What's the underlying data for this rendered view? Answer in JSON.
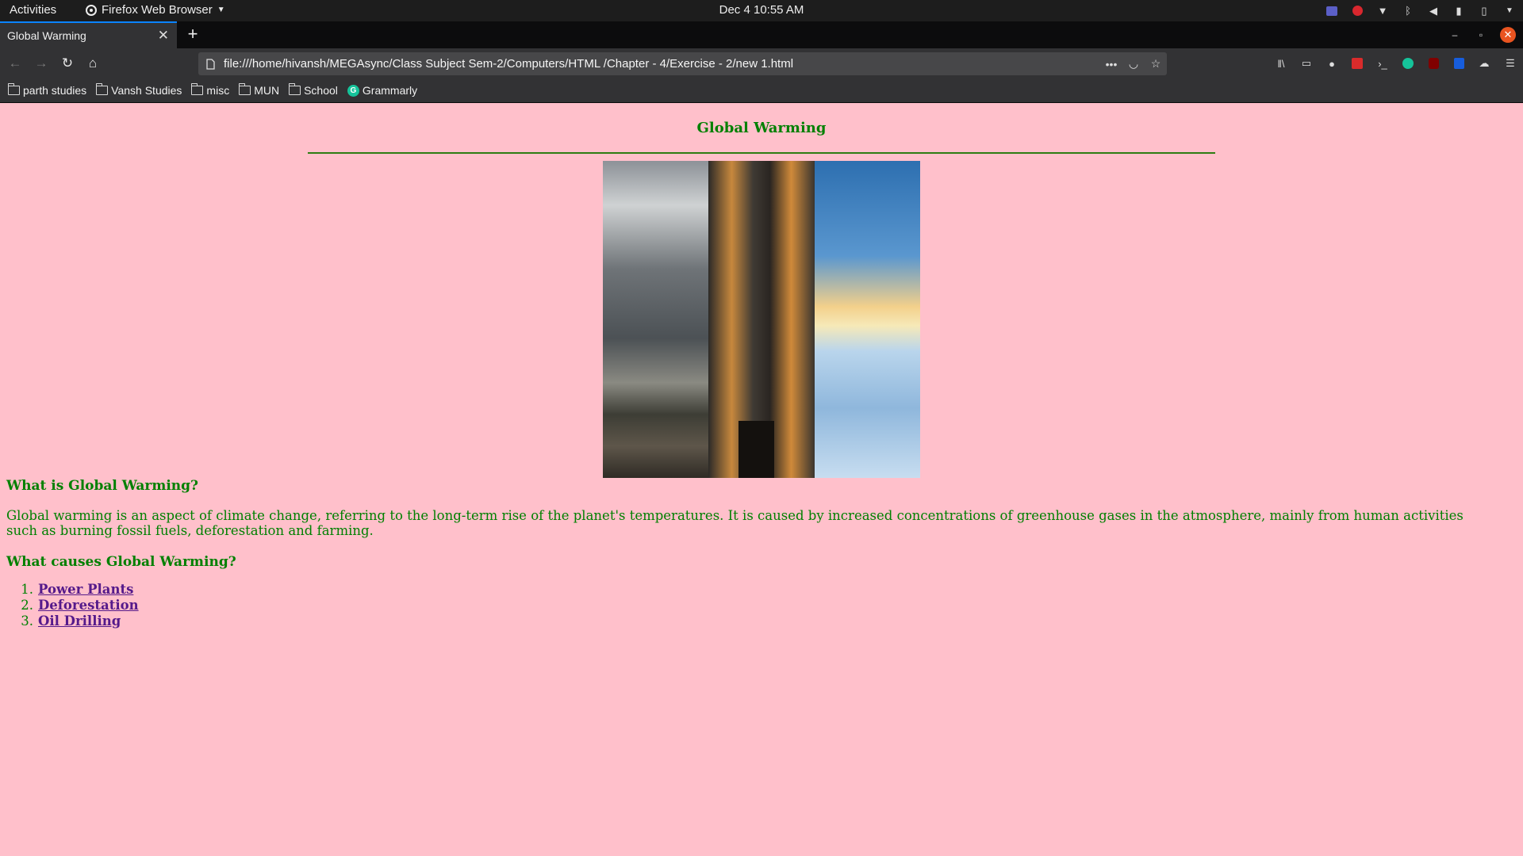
{
  "system": {
    "activities_label": "Activities",
    "app_name": "Firefox Web Browser",
    "clock": "Dec 4  10:55 AM"
  },
  "browser": {
    "tab_title": "Global Warming",
    "url": "file:///home/hivansh/MEGAsync/Class Subject Sem-2/Computers/HTML /Chapter - 4/Exercise - 2/new 1.html",
    "bookmarks": [
      {
        "label": "parth studies",
        "icon": "folder-icon"
      },
      {
        "label": "Vansh Studies",
        "icon": "folder-icon"
      },
      {
        "label": "misc",
        "icon": "folder-icon"
      },
      {
        "label": "MUN",
        "icon": "folder-icon"
      },
      {
        "label": "School",
        "icon": "folder-icon"
      },
      {
        "label": "Grammarly",
        "icon": "grammarly-icon"
      }
    ]
  },
  "page": {
    "title": "Global Warming",
    "section1_heading": "What is Global Warming?",
    "paragraph": "Global warming is an aspect of climate change, referring to the long-term rise of the planet's temperatures. It is caused by increased concentrations of greenhouse gases in the atmosphere, mainly from human activities such as burning fossil fuels, deforestation and farming.",
    "section2_heading": "What causes Global Warming?",
    "causes": [
      {
        "num": "1.",
        "label": "Power Plants"
      },
      {
        "num": "2.",
        "label": "Deforestation"
      },
      {
        "num": "3.",
        "label": "Oil Drilling"
      }
    ]
  },
  "colors": {
    "page_background": "#ffc0cb",
    "text_green": "#008000",
    "link_visited": "#551a8b"
  }
}
